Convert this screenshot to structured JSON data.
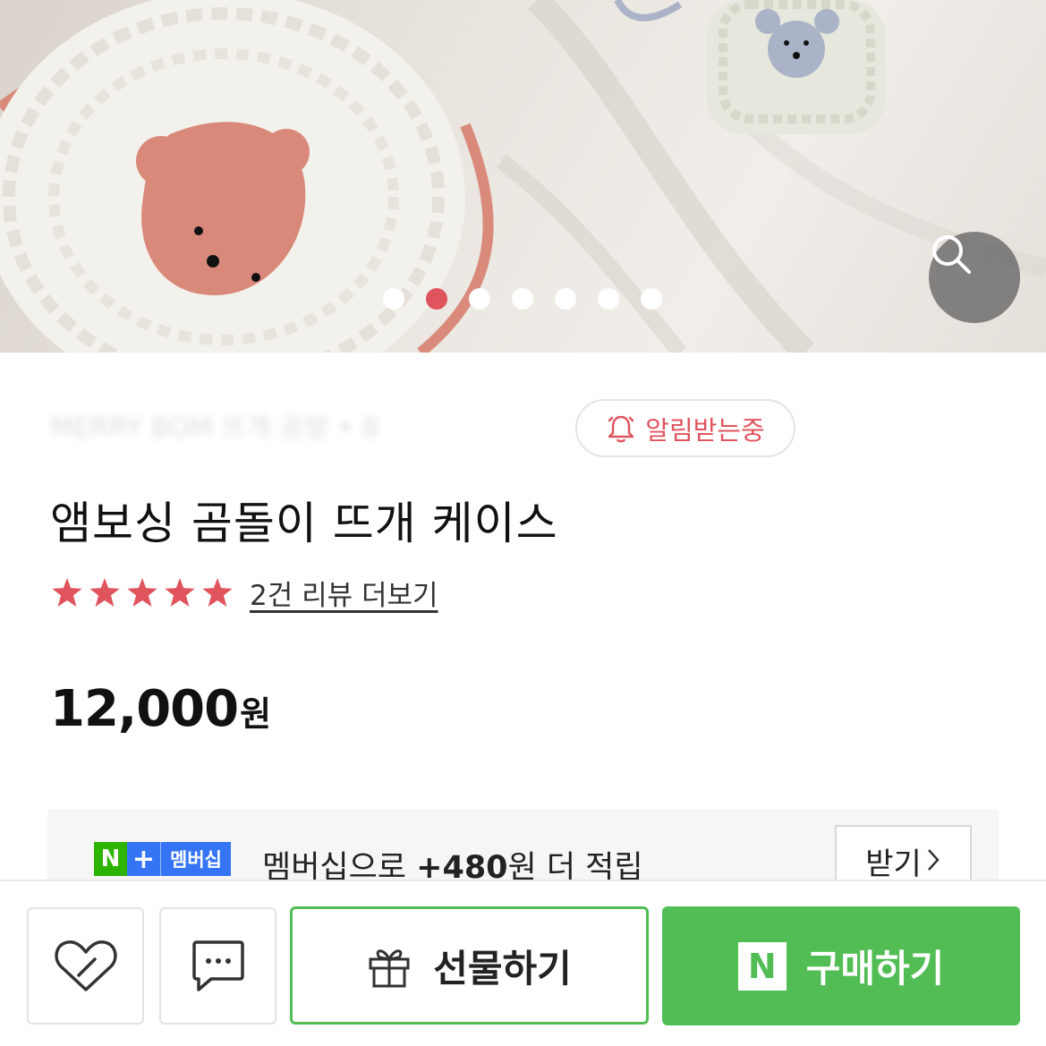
{
  "hero": {
    "image_alt": "crochet bear pouch",
    "slide_total": 7,
    "slide_active": 2,
    "zoom_icon": "search-icon"
  },
  "seller": {
    "name": "MERRY BOM 뜨개 공방 • 8",
    "notify_label": "알림받는중",
    "notify_icon": "bell-icon"
  },
  "product": {
    "title": "앰보싱 곰돌이 뜨개 케이스",
    "rating_stars": 5,
    "review_link": "2건 리뷰 더보기",
    "price": "12,000",
    "price_unit": "원"
  },
  "membership": {
    "badge_n": "N",
    "badge_plus": "+",
    "badge_text": "멤버십",
    "text_prefix": "멤버십으로 ",
    "points": "+480",
    "text_suffix": "원 더 적립",
    "receive_label": "받기"
  },
  "bottom_bar": {
    "wishlist_icon": "heart-icon",
    "chat_icon": "chat-icon",
    "gift_label": "선물하기",
    "gift_icon": "gift-icon",
    "buy_logo": "N",
    "buy_label": "구매하기"
  },
  "colors": {
    "accent_red": "#e0545e",
    "naver_green": "#51bd54",
    "membership_blue": "#3575f5",
    "badge_green": "#2db400"
  }
}
